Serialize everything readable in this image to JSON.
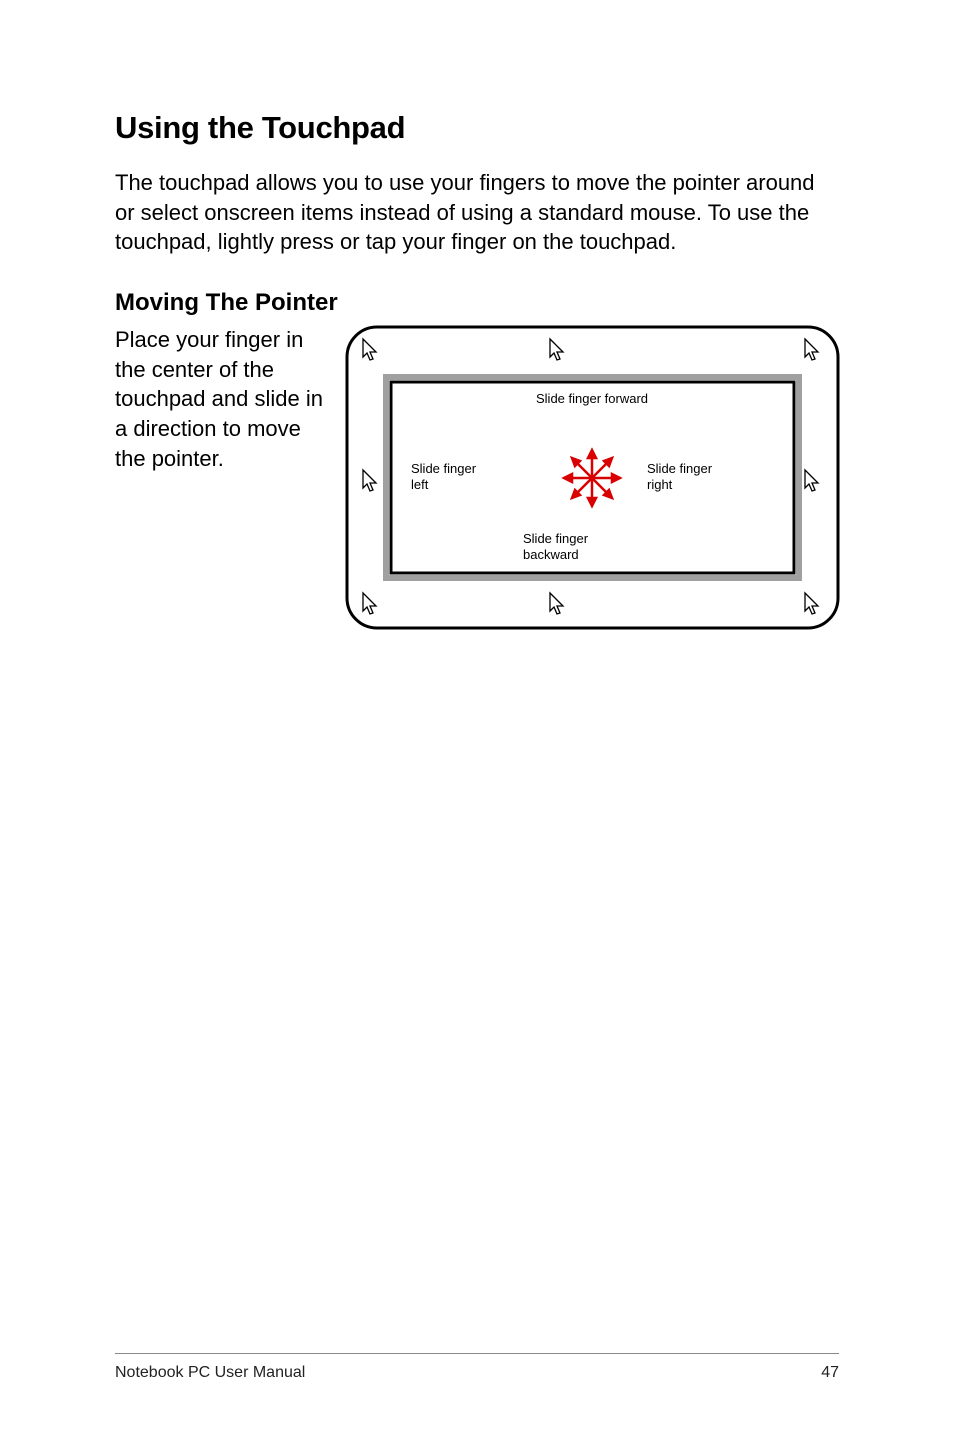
{
  "heading": "Using the Touchpad",
  "intro": "The touchpad allows you to use your fingers to move the pointer around or select onscreen items instead of using a standard mouse. To use the touchpad, lightly press or tap your finger on the touchpad.",
  "subheading": "Moving The Pointer",
  "sidetext": "Place your finger in the center of the touchpad and slide in a direction to move the pointer.",
  "diagram": {
    "label_forward": "Slide finger forward",
    "label_left": "Slide finger left",
    "label_right": "Slide finger right",
    "label_backward": "Slide finger backward"
  },
  "footer": {
    "left": "Notebook PC User Manual",
    "right": "47"
  }
}
